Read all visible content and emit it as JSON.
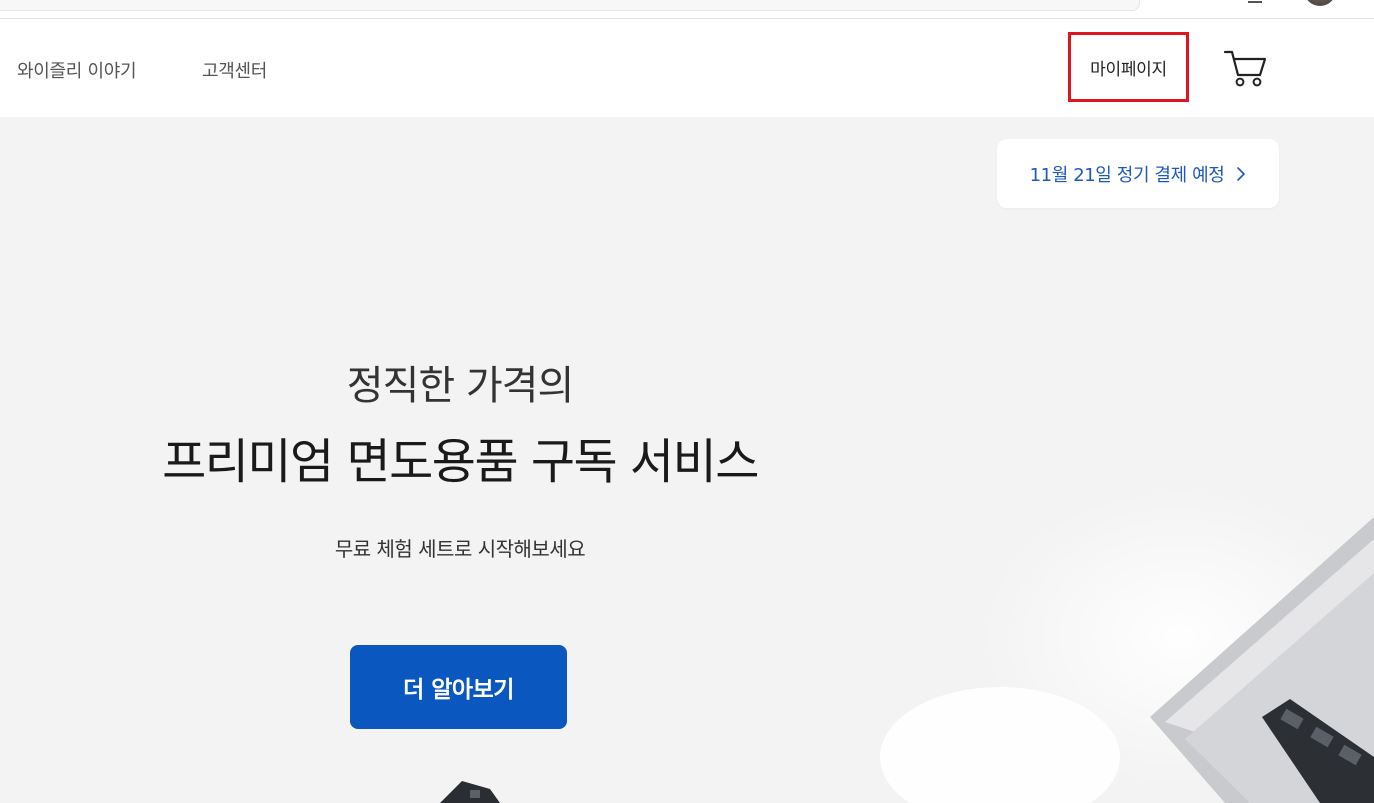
{
  "browser": {
    "icons": [
      "avatar"
    ]
  },
  "nav": {
    "links": [
      "와이즐리 이야기",
      "고객센터"
    ],
    "mypage_label": "마이페이지",
    "cart_icon": "cart-icon"
  },
  "hero": {
    "billing_notice": "11월 21일 정기 결제 예정",
    "headline_line1": "정직한 가격의",
    "headline_line2": "프리미엄 면도용품 구독 서비스",
    "subline": "무료 체험 세트로 시작해보세요",
    "cta_label": "더 알아보기"
  },
  "colors": {
    "accent": "#0a57bf",
    "notice_text": "#1d59bd",
    "highlight_border": "#e0161e",
    "hero_bg": "#f3f3f3"
  }
}
